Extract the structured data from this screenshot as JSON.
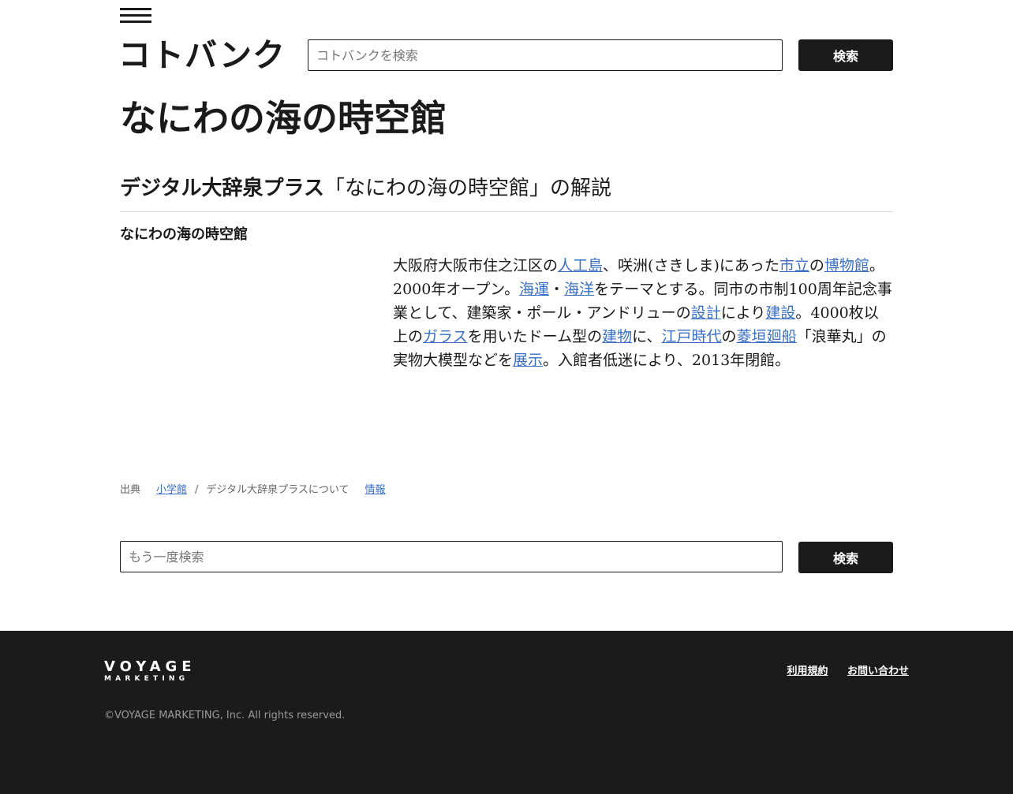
{
  "header": {
    "menu_icon": "hamburger-menu-icon",
    "logo": "コトバンク",
    "search": {
      "placeholder": "コトバンクを検索",
      "value": "",
      "button_label": "検索"
    }
  },
  "page": {
    "title": "なにわの海の時空館"
  },
  "dictionary": {
    "name": "デジタル大辞泉プラス",
    "suffix": "「なにわの海の時空館」の解説"
  },
  "entry": {
    "title": "なにわの海の時空館",
    "segments": [
      {
        "text": "大阪府大阪市住之江区の",
        "link": false
      },
      {
        "text": "人工島",
        "link": true
      },
      {
        "text": "、咲洲(さきしま)にあった",
        "link": false
      },
      {
        "text": "市立",
        "link": true
      },
      {
        "text": "の",
        "link": false
      },
      {
        "text": "博物館",
        "link": true
      },
      {
        "text": "。2000年オープン。",
        "link": false
      },
      {
        "text": "海運",
        "link": true
      },
      {
        "text": "・",
        "link": false
      },
      {
        "text": "海洋",
        "link": true
      },
      {
        "text": "をテーマとする。同市の市制100周年記念事業として、建築家・ポール・アンドリューの",
        "link": false
      },
      {
        "text": "設計",
        "link": true
      },
      {
        "text": "により",
        "link": false
      },
      {
        "text": "建設",
        "link": true
      },
      {
        "text": "。4000枚以上の",
        "link": false
      },
      {
        "text": "ガラス",
        "link": true
      },
      {
        "text": "を用いたドーム型の",
        "link": false
      },
      {
        "text": "建物",
        "link": true
      },
      {
        "text": "に、",
        "link": false
      },
      {
        "text": "江戸時代",
        "link": true
      },
      {
        "text": "の",
        "link": false
      },
      {
        "text": "菱垣廻船",
        "link": true
      },
      {
        "text": "「浪華丸」の実物大模型などを",
        "link": false
      },
      {
        "text": "展示",
        "link": true
      },
      {
        "text": "。入館者低迷により、2013年閉館。",
        "link": false
      }
    ]
  },
  "source": {
    "label": "出典",
    "publisher": "小学館",
    "separator": "/",
    "about": "デジタル大辞泉プラスについて",
    "info": "情報"
  },
  "bottom_search": {
    "placeholder": "もう一度検索",
    "value": "",
    "button_label": "検索"
  },
  "footer": {
    "logo_line1": "VOYAGE",
    "logo_line2": "MARKETING",
    "links": [
      "利用規約",
      "お問い合わせ"
    ],
    "copyright": "©VOYAGE MARKETING, Inc. All rights reserved."
  },
  "colors": {
    "link": "#3a6fc4",
    "dark": "#1a1a1a",
    "footer_bg": "#1b1b1b"
  }
}
